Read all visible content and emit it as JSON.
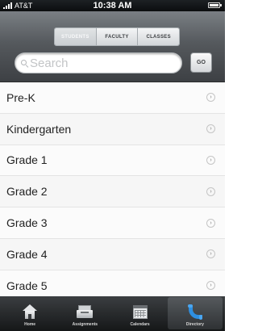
{
  "status_bar": {
    "carrier": "AT&T",
    "time": "10:38 AM"
  },
  "segmented_control": {
    "options": [
      "STUDENTS",
      "FACULTY",
      "CLASSES"
    ],
    "selected": "STUDENTS"
  },
  "search": {
    "placeholder": "Search",
    "value": "",
    "go_label": "GO"
  },
  "list": {
    "items": [
      "Pre-K",
      "Kindergarten",
      "Grade 1",
      "Grade 2",
      "Grade 3",
      "Grade 4",
      "Grade 5"
    ]
  },
  "tab_bar": {
    "tabs": [
      {
        "label": "Home",
        "icon": "home-icon"
      },
      {
        "label": "Assignments",
        "icon": "tray-icon"
      },
      {
        "label": "Calendars",
        "icon": "calendar-icon"
      },
      {
        "label": "Directory",
        "icon": "phone-icon"
      }
    ],
    "active": "Directory"
  },
  "colors": {
    "accent": "#2e8fe0",
    "header": "#55595d",
    "tab_bar": "#151718"
  }
}
